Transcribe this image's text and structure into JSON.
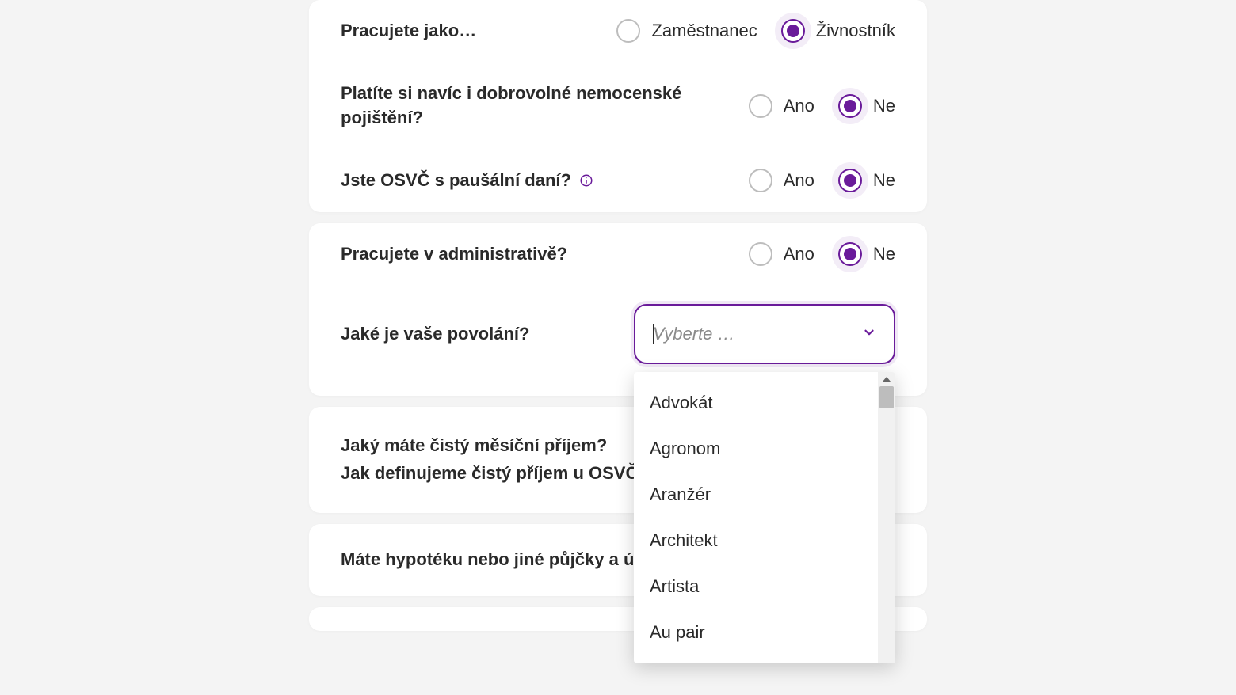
{
  "card1": {
    "q1": {
      "label": "Pracujete jako…",
      "opt_a": "Zaměstnanec",
      "opt_b": "Živnostník"
    },
    "q2": {
      "label": "Platíte si navíc i dobrovolné nemocenské pojištění?",
      "opt_a": "Ano",
      "opt_b": "Ne"
    },
    "q3": {
      "label": "Jste OSVČ s paušální daní?",
      "opt_a": "Ano",
      "opt_b": "Ne"
    }
  },
  "card2": {
    "q4": {
      "label": "Pracujete v administrativě?",
      "opt_a": "Ano",
      "opt_b": "Ne"
    },
    "q5": {
      "label": "Jaké je vaše povolání?",
      "placeholder": "Vyberte …"
    },
    "dropdown": {
      "items": [
        "Advokát",
        "Agronom",
        "Aranžér",
        "Architekt",
        "Artista",
        "Au pair"
      ]
    }
  },
  "card3": {
    "q6_a": "Jaký máte čistý měsíční příjem?",
    "q6_b": "Jak definujeme čistý příjem u OSVČ?"
  },
  "card4": {
    "q7": "Máte hypotéku nebo jiné půjčky a úvěry, které chcete pojistit?"
  }
}
